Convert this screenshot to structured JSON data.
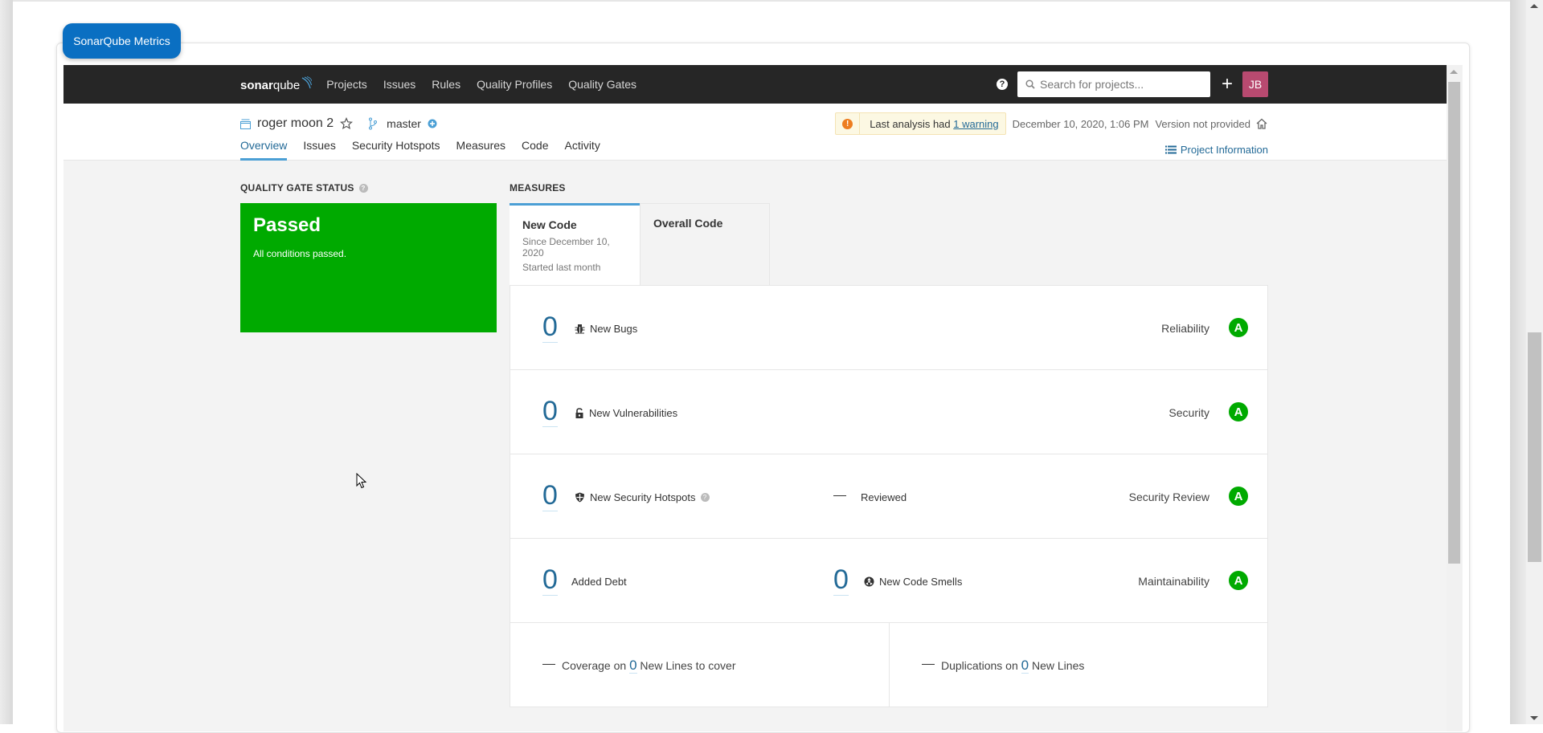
{
  "widget_badge": "SonarQube Metrics",
  "topnav": {
    "logo_bold": "sonar",
    "logo_light": "qube",
    "links": [
      "Projects",
      "Issues",
      "Rules",
      "Quality Profiles",
      "Quality Gates"
    ],
    "search_placeholder": "Search for projects...",
    "avatar_initials": "JB",
    "avatar_color": "#b84a70"
  },
  "project": {
    "name": "roger moon 2",
    "branch": "master",
    "warning_prefix": "Last analysis had ",
    "warning_link": "1 warning",
    "analysis_date": "December 10, 2020, 1:06 PM",
    "version": "Version not provided",
    "tabs": [
      "Overview",
      "Issues",
      "Security Hotspots",
      "Measures",
      "Code",
      "Activity"
    ],
    "active_tab": "Overview",
    "project_info_label": "Project Information"
  },
  "quality_gate": {
    "label": "QUALITY GATE STATUS",
    "status": "Passed",
    "message": "All conditions passed.",
    "color": "#00aa00"
  },
  "measures": {
    "label": "MEASURES",
    "tabs": [
      {
        "title": "New Code",
        "since_line": "Since December 10, 2020",
        "started": "Started last month",
        "active": true
      },
      {
        "title": "Overall Code",
        "active": false
      }
    ],
    "rows": [
      {
        "value": "0",
        "label": "New Bugs",
        "icon": "bug-icon",
        "rating_label": "Reliability",
        "rating": "A"
      },
      {
        "value": "0",
        "label": "New Vulnerabilities",
        "icon": "lock-icon",
        "rating_label": "Security",
        "rating": "A"
      },
      {
        "value": "0",
        "label": "New Security Hotspots",
        "icon": "shield-icon",
        "secondary_value": "—",
        "secondary_label": "Reviewed",
        "rating_label": "Security Review",
        "rating": "A"
      },
      {
        "value": "0",
        "label": "Added Debt",
        "secondary_value": "0",
        "secondary_label": "New Code Smells",
        "secondary_icon": "code-smell-icon",
        "rating_label": "Maintainability",
        "rating": "A"
      }
    ],
    "coverage": {
      "dash": "—",
      "prefix": "Coverage on ",
      "value": "0",
      "suffix": " New Lines to cover"
    },
    "duplications": {
      "dash": "—",
      "prefix": "Duplications on ",
      "value": "0",
      "suffix": " New Lines"
    }
  }
}
